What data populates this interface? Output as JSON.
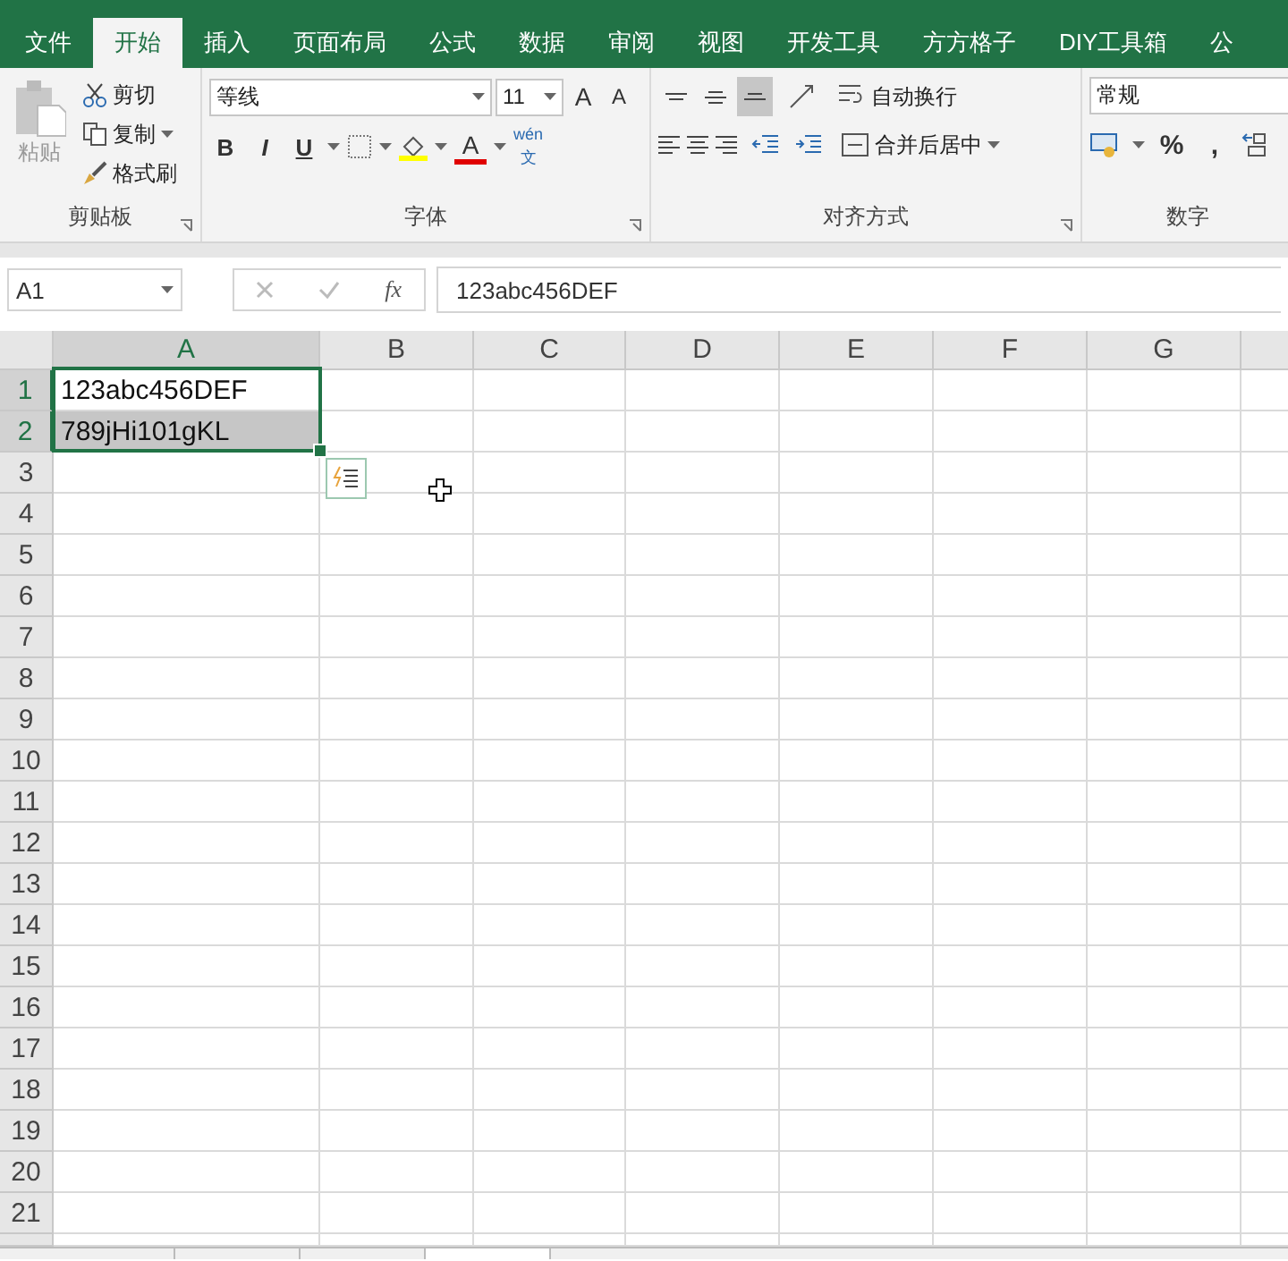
{
  "tabs": [
    {
      "label": "文件",
      "selected": false
    },
    {
      "label": "开始",
      "selected": true
    },
    {
      "label": "插入",
      "selected": false
    },
    {
      "label": "页面布局",
      "selected": false
    },
    {
      "label": "公式",
      "selected": false
    },
    {
      "label": "数据",
      "selected": false
    },
    {
      "label": "审阅",
      "selected": false
    },
    {
      "label": "视图",
      "selected": false
    },
    {
      "label": "开发工具",
      "selected": false
    },
    {
      "label": "方方格子",
      "selected": false
    },
    {
      "label": "DIY工具箱",
      "selected": false
    },
    {
      "label": "公",
      "selected": false
    }
  ],
  "clipboard": {
    "paste": "粘贴",
    "cut": "剪切",
    "copy": "复制",
    "format_painter": "格式刷",
    "title": "剪贴板"
  },
  "font": {
    "name": "等线",
    "size": "11",
    "grow": "A",
    "shrink": "A",
    "bold": "B",
    "italic": "I",
    "underline": "U",
    "font_color": "A",
    "phonetic_top": "wén",
    "phonetic_bottom": "文",
    "title": "字体"
  },
  "alignment": {
    "vertical": [
      {
        "kind": "top",
        "selected": false
      },
      {
        "kind": "middle",
        "selected": false
      },
      {
        "kind": "bottom",
        "selected": true
      }
    ],
    "wrap": "自动换行",
    "merge": "合并后居中",
    "title": "对齐方式"
  },
  "number": {
    "format": "常规",
    "percent": "%",
    "comma": ",",
    "title": "数字"
  },
  "formula_bar": {
    "name_box": "A1",
    "fx": "fx",
    "value": "123abc456DEF"
  },
  "grid": {
    "columns": [
      {
        "label": "A",
        "selected": true
      },
      {
        "label": "B",
        "selected": false
      },
      {
        "label": "C",
        "selected": false
      },
      {
        "label": "D",
        "selected": false
      },
      {
        "label": "E",
        "selected": false
      },
      {
        "label": "F",
        "selected": false
      },
      {
        "label": "G",
        "selected": false
      }
    ],
    "rows": [
      {
        "label": "1",
        "selected": true,
        "cells": [
          {
            "text": "123abc456DEF",
            "highlighted": false
          }
        ]
      },
      {
        "label": "2",
        "selected": true,
        "cells": [
          {
            "text": "789jHi101gKL",
            "highlighted": true
          }
        ]
      },
      {
        "label": "3",
        "selected": false,
        "cells": []
      },
      {
        "label": "4",
        "selected": false,
        "cells": []
      },
      {
        "label": "5",
        "selected": false,
        "cells": []
      },
      {
        "label": "6",
        "selected": false,
        "cells": []
      },
      {
        "label": "7",
        "selected": false,
        "cells": []
      },
      {
        "label": "8",
        "selected": false,
        "cells": []
      },
      {
        "label": "9",
        "selected": false,
        "cells": []
      },
      {
        "label": "10",
        "selected": false,
        "cells": []
      },
      {
        "label": "11",
        "selected": false,
        "cells": []
      },
      {
        "label": "12",
        "selected": false,
        "cells": []
      },
      {
        "label": "13",
        "selected": false,
        "cells": []
      },
      {
        "label": "14",
        "selected": false,
        "cells": []
      },
      {
        "label": "15",
        "selected": false,
        "cells": []
      },
      {
        "label": "16",
        "selected": false,
        "cells": []
      },
      {
        "label": "17",
        "selected": false,
        "cells": []
      },
      {
        "label": "18",
        "selected": false,
        "cells": []
      },
      {
        "label": "19",
        "selected": false,
        "cells": []
      },
      {
        "label": "20",
        "selected": false,
        "cells": []
      },
      {
        "label": "21",
        "selected": false,
        "cells": []
      }
    ]
  }
}
